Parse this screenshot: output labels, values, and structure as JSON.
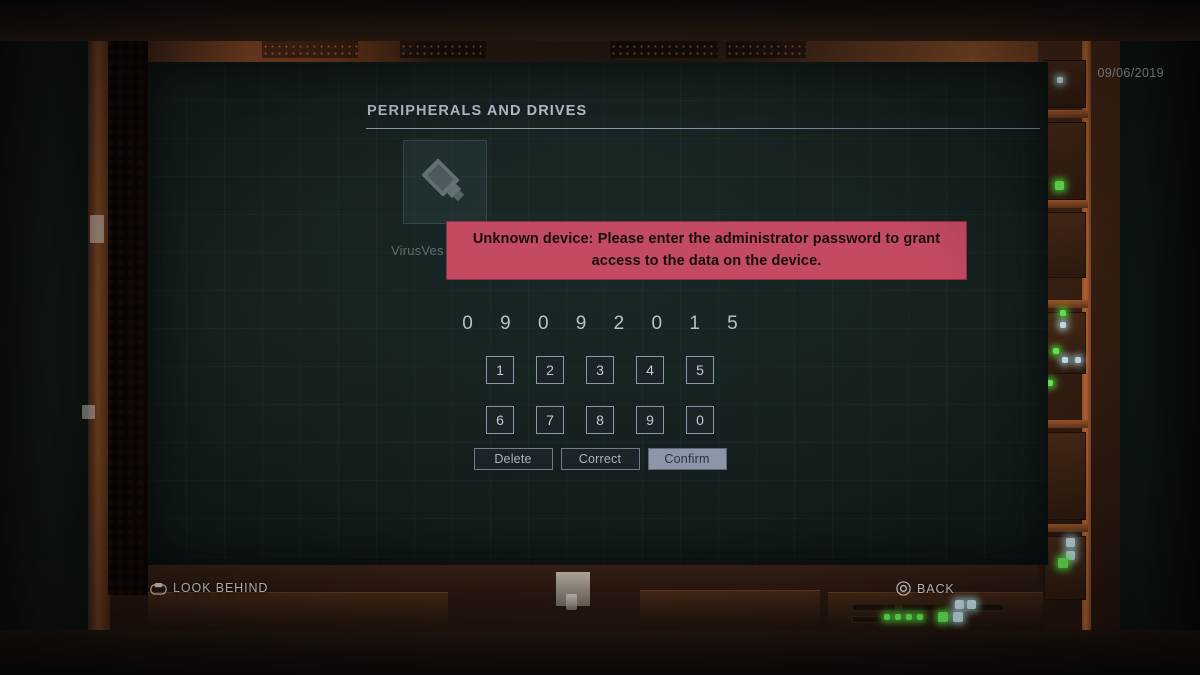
{
  "hud": {
    "date": "09/06/2019",
    "look_behind_label": "LOOK BEHIND",
    "look_behind_icon": "shoulder-button-icon",
    "back_label": "BACK",
    "back_icon": "circle-button-icon"
  },
  "screen": {
    "section_title": "PERIPHERALS AND DRIVES",
    "device": {
      "icon": "usb-drive-icon",
      "label": "VirusVes"
    },
    "alert": {
      "text": "Unknown device: Please enter the administrator password to grant access to the data on the device.",
      "background_color": "#c44a62",
      "text_color": "#16100f"
    },
    "password": {
      "entered_value": "0 9 0 9 2 0 1 5",
      "keypad_rows": [
        [
          "1",
          "2",
          "3",
          "4",
          "5"
        ],
        [
          "6",
          "7",
          "8",
          "9",
          "0"
        ]
      ],
      "actions": [
        {
          "label": "Delete",
          "selected": false
        },
        {
          "label": "Correct",
          "selected": false
        },
        {
          "label": "Confirm",
          "selected": true
        }
      ]
    }
  },
  "colors": {
    "screen_bg": "#16211f",
    "accent_text": "#b9c2d1",
    "key_border": "#8b97ab",
    "selected_fill": "#8c96a9",
    "alert": "#c44a62"
  }
}
